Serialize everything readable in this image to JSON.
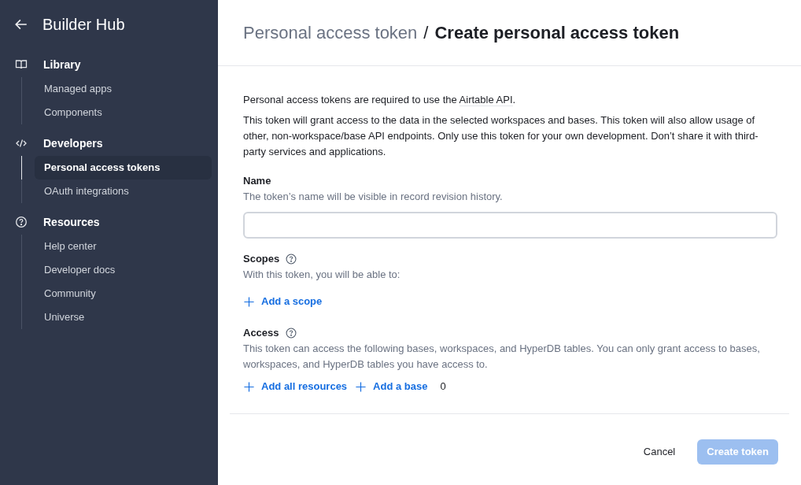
{
  "sidebar": {
    "title": "Builder Hub",
    "sections": [
      {
        "label": "Library",
        "kind": "book",
        "items": [
          {
            "label": "Managed apps",
            "selected": false
          },
          {
            "label": "Components",
            "selected": false
          }
        ]
      },
      {
        "label": "Developers",
        "kind": "code",
        "items": [
          {
            "label": "Personal access tokens",
            "selected": true
          },
          {
            "label": "OAuth integrations",
            "selected": false
          }
        ]
      },
      {
        "label": "Resources",
        "kind": "help",
        "items": [
          {
            "label": "Help center",
            "selected": false
          },
          {
            "label": "Developer docs",
            "selected": false
          },
          {
            "label": "Community",
            "selected": false
          },
          {
            "label": "Universe",
            "selected": false
          }
        ]
      }
    ]
  },
  "header": {
    "breadcrumb": "Personal access token",
    "separator": "/",
    "title": "Create personal access token"
  },
  "intro": {
    "before": "Personal access tokens are required to use the ",
    "link": "Airtable API",
    "after": "."
  },
  "description": "This token will grant access to the data in the selected workspaces and bases. This token will also allow usage of other, non-workspace/base API endpoints. Only use this token for your own development. Don’t share it with third-party services and applications.",
  "name_field": {
    "label": "Name",
    "hint": "The token’s name will be visible in record revision history."
  },
  "scopes": {
    "label": "Scopes",
    "hint": "With this token, you will be able to:",
    "actions": [
      "Add a scope"
    ]
  },
  "access": {
    "label": "Access",
    "hint": "This token can access the following bases, workspaces, and HyperDB tables. You can only grant access to bases, workspaces, and HyperDB tables you have access to.",
    "actions": [
      "Add all resources",
      "Add a base"
    ],
    "count": "0"
  },
  "footer": {
    "cancel": "Cancel",
    "create": {
      "label": "Create token",
      "disabled": true
    }
  }
}
